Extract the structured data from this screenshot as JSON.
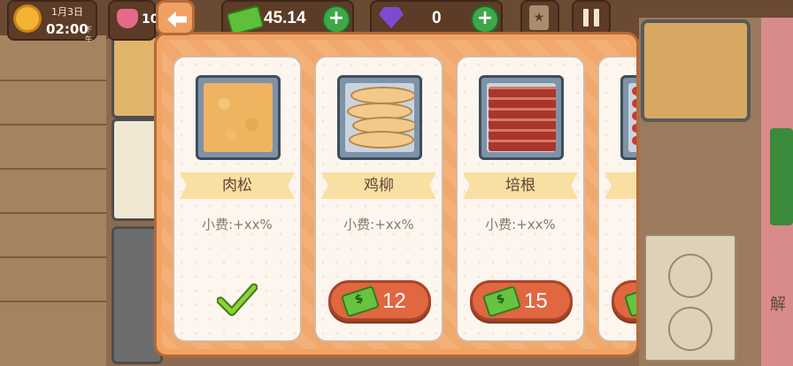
{
  "hud": {
    "date": "1月3日",
    "time": "02:00",
    "ampm": "下午",
    "hearts": "10",
    "money": "45.14",
    "gems": "0",
    "money_icon": "cash-icon",
    "gem_icon": "gem-icon",
    "plus_label": "+"
  },
  "background": {
    "unlock_text": "解"
  },
  "modal": {
    "back_icon": "back-arrow-icon",
    "items": [
      {
        "name": "肉松",
        "tip": "小费:+xx%",
        "owned": true,
        "price": ""
      },
      {
        "name": "鸡柳",
        "tip": "小费:+xx%",
        "owned": false,
        "price": "12"
      },
      {
        "name": "培根",
        "tip": "小费:+xx%",
        "owned": false,
        "price": "15"
      },
      {
        "name": "",
        "tip": "小",
        "owned": false,
        "price": ""
      }
    ]
  },
  "colors": {
    "modal_bg": "#f2a464",
    "buy_button": "#e0673f",
    "check": "#6fb02a"
  }
}
